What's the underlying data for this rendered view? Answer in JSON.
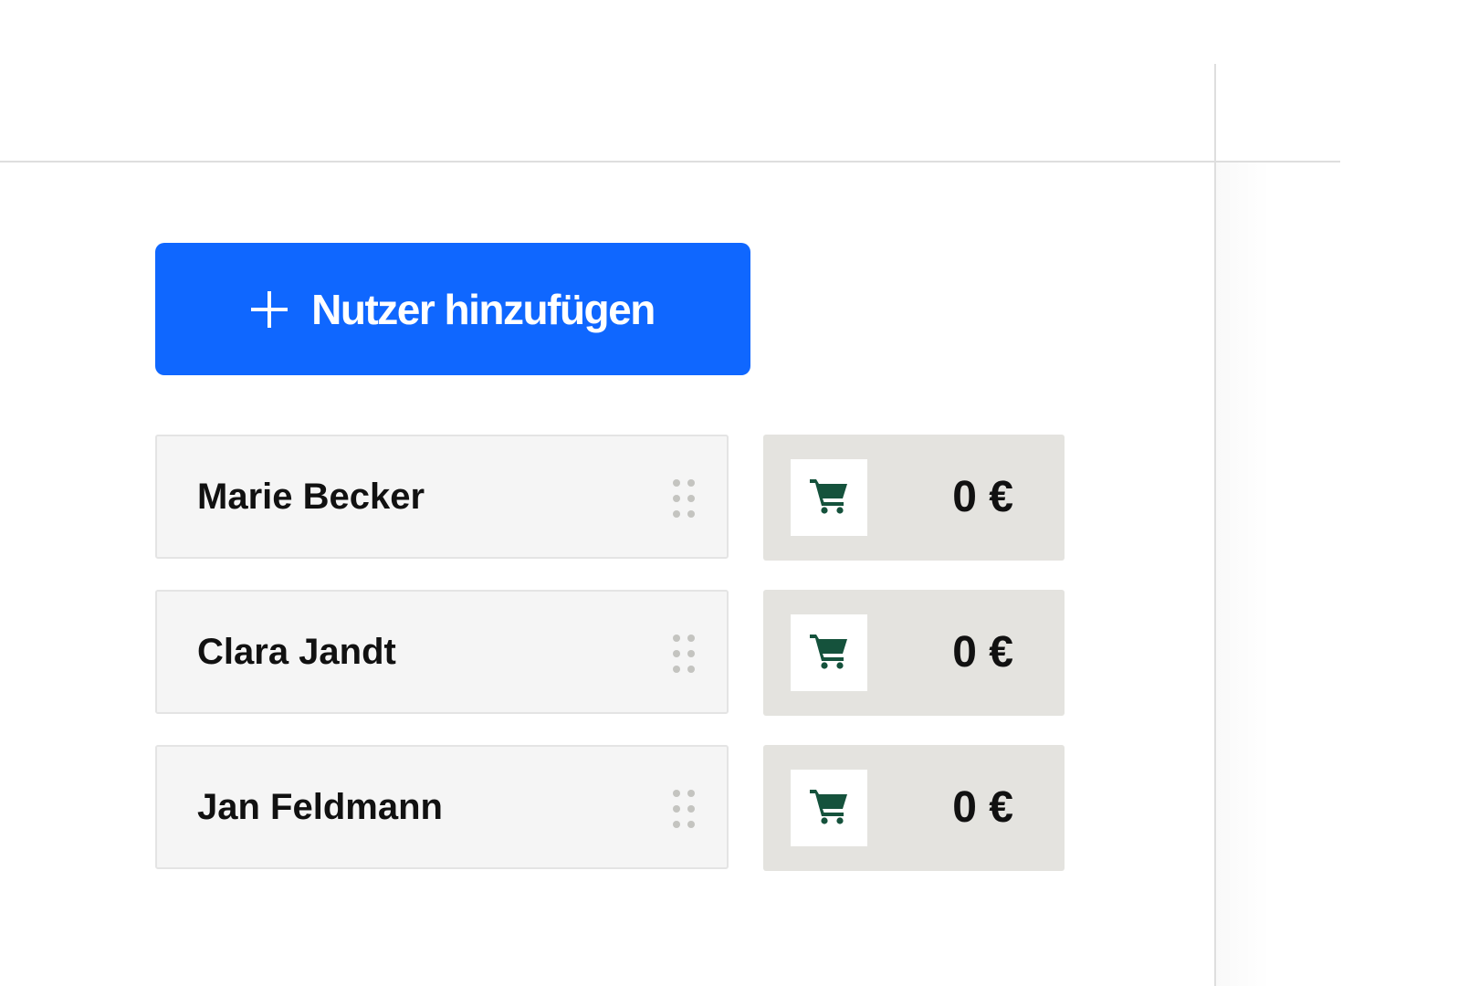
{
  "toolbar": {
    "add_user_label": "Nutzer hinzufügen",
    "add_user_icon": "plus-icon",
    "accent_color": "#0f67ff"
  },
  "users": [
    {
      "name": "Marie Becker",
      "amount": "0 €",
      "drag_icon": "drag-handle-icon",
      "cart_icon": "cart-icon"
    },
    {
      "name": "Clara Jandt",
      "amount": "0 €",
      "drag_icon": "drag-handle-icon",
      "cart_icon": "cart-icon"
    },
    {
      "name": "Jan Feldmann",
      "amount": "0 €",
      "drag_icon": "drag-handle-icon",
      "cart_icon": "cart-icon"
    }
  ],
  "colors": {
    "cart_icon": "#15523c",
    "name_card_bg": "#f5f5f5",
    "amount_card_bg": "#e4e3df",
    "divider": "#dedede"
  }
}
